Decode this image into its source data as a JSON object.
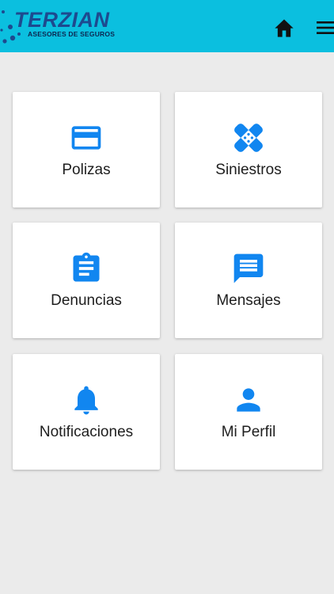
{
  "header": {
    "logo_name": "TERZIAN",
    "logo_tagline": "ASESORES DE SEGUROS",
    "home_icon": "home-icon",
    "menu_icon": "hamburger-menu-icon",
    "bar_color": "#0bbfdf"
  },
  "accent_color": "#1186f0",
  "menu": [
    {
      "label": "Polizas",
      "icon": "credit-card-icon"
    },
    {
      "label": "Siniestros",
      "icon": "bandage-icon"
    },
    {
      "label": "Denuncias",
      "icon": "clipboard-icon"
    },
    {
      "label": "Mensajes",
      "icon": "message-icon"
    },
    {
      "label": "Notificaciones",
      "icon": "bell-icon"
    },
    {
      "label": "Mi Perfil",
      "icon": "person-icon"
    }
  ]
}
